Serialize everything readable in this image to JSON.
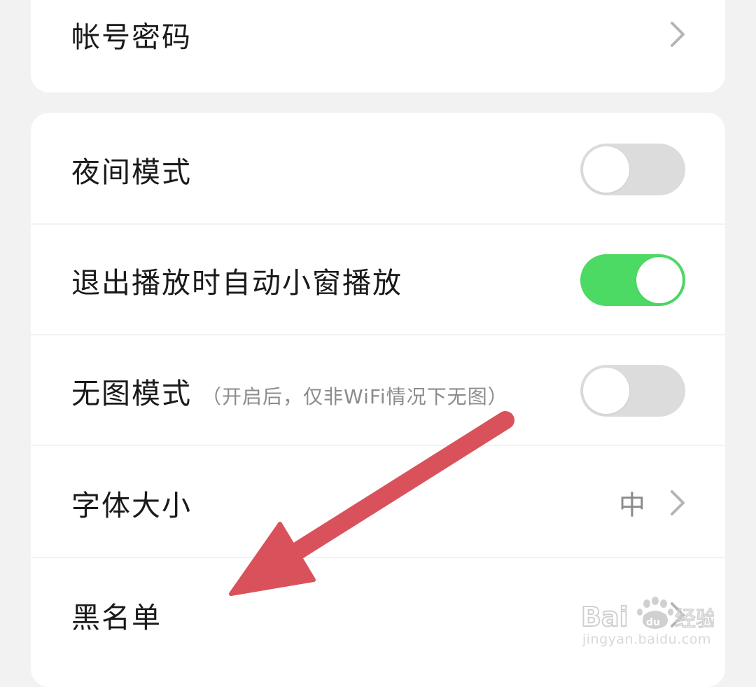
{
  "account_section": {
    "rows": [
      {
        "label": "帐号密码"
      }
    ]
  },
  "settings_section": {
    "night_mode": {
      "label": "夜间模式",
      "enabled": false
    },
    "auto_pip": {
      "label": "退出播放时自动小窗播放",
      "enabled": true
    },
    "no_image_mode": {
      "label": "无图模式",
      "hint": "（开启后，仅非WiFi情况下无图）",
      "enabled": false
    },
    "font_size": {
      "label": "字体大小",
      "value": "中"
    },
    "blacklist": {
      "label": "黑名单"
    }
  },
  "annotation": {
    "type": "arrow",
    "color": "#d9525b",
    "points_to": "黑名单"
  },
  "watermark": {
    "logo": "Baidu经验",
    "url": "jingyan.baidu.com"
  },
  "colors": {
    "toggle_on": "#4cd964",
    "toggle_off": "#dcdcdc",
    "background": "#f2f2f2",
    "card": "#ffffff"
  }
}
